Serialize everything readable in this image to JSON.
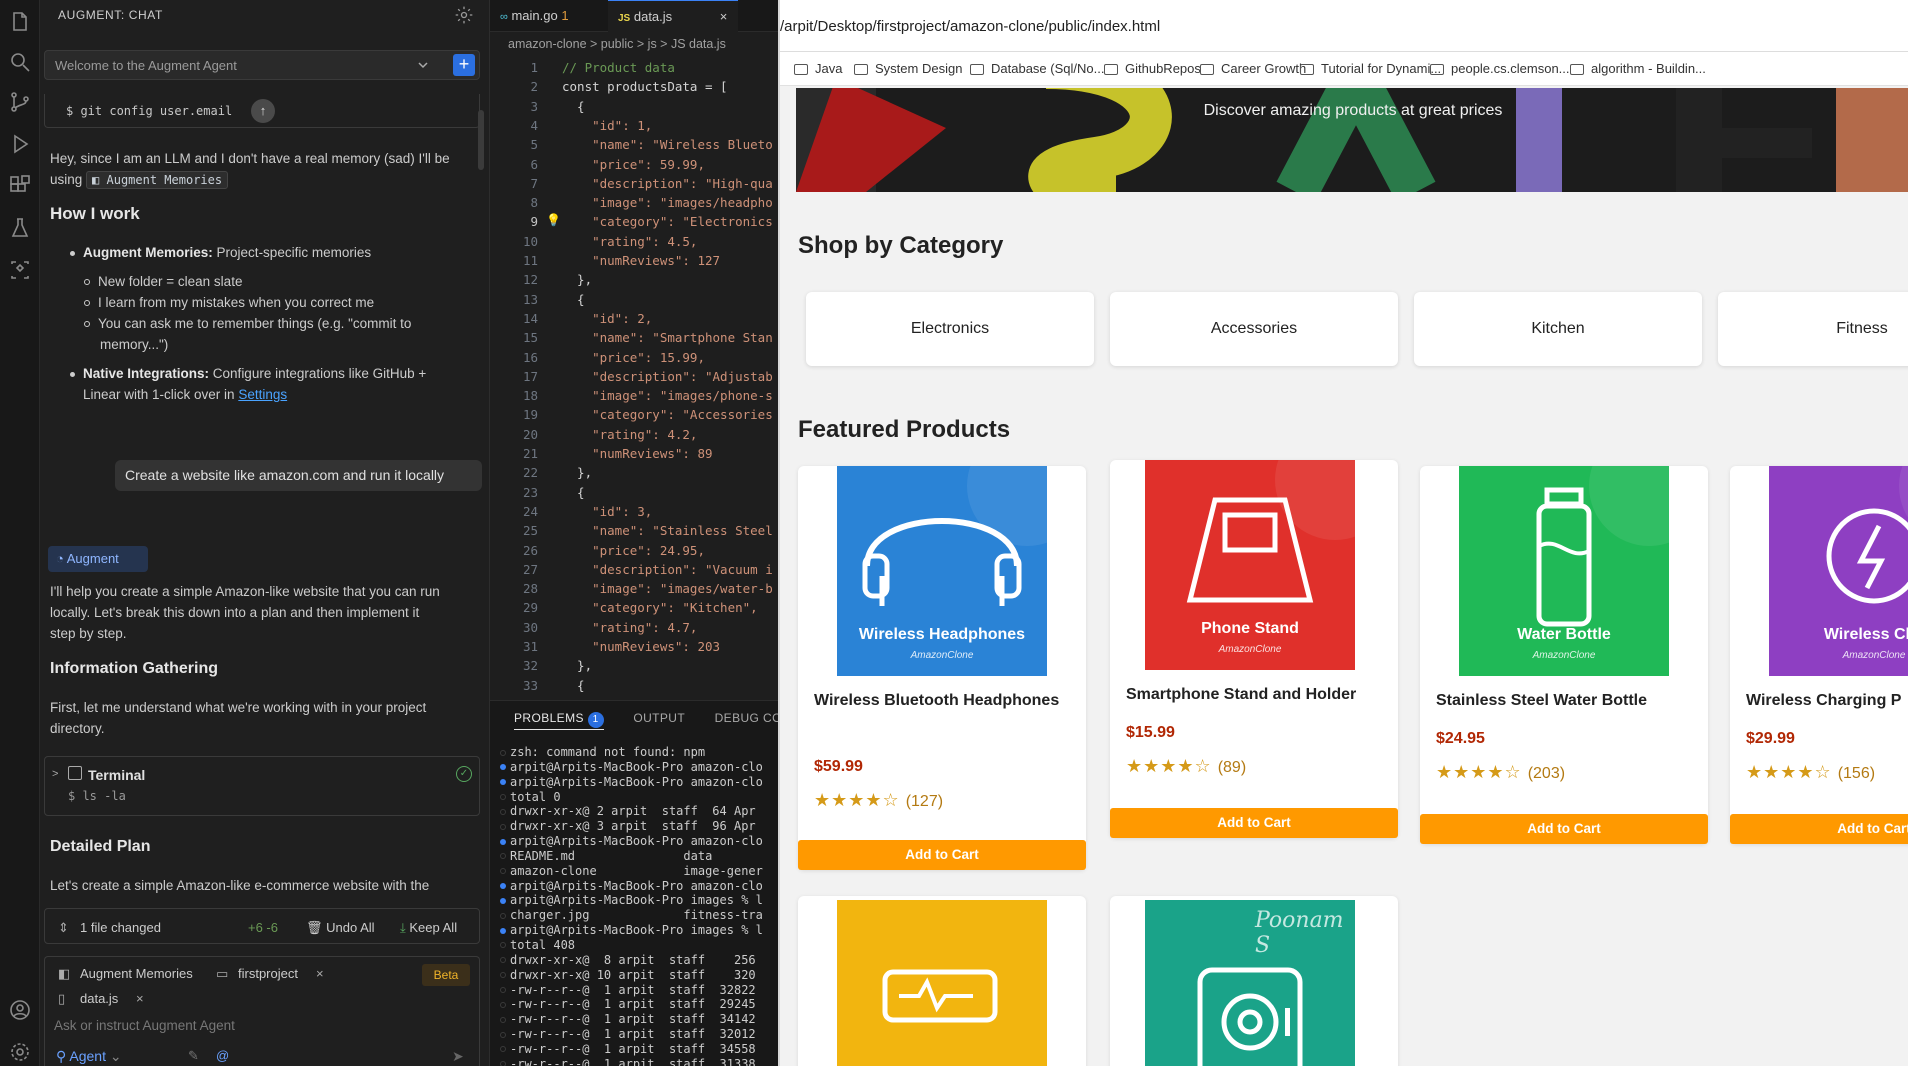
{
  "chat": {
    "title": "AUGMENT: CHAT",
    "welcome": "Welcome to the Augment Agent",
    "git_command": "$ git config user.email",
    "intro": "Hey, since I am an LLM and I don't have a real memory (sad) I'll be using",
    "intro_chip": "Augment Memories",
    "how_title": "How I work",
    "mem_label": "Augment Memories:",
    "mem_text": "Project-specific memories",
    "sub1": "New folder = clean slate",
    "sub2": "I learn from my mistakes when you correct me",
    "sub3_a": "You can ask me to remember things (e.g. \"commit to",
    "sub3_b": "memory...\")",
    "native_label": "Native Integrations:",
    "native_text_a": "Configure integrations like GitHub +",
    "native_text_b": "Linear with 1-click over in",
    "settings_link": "Settings",
    "user_msg": "Create a website like amazon.com and run it locally",
    "agent_tag": "Augment",
    "reply_a": "I'll help you create a simple Amazon-like website that you can run",
    "reply_b": "locally. Let's break this down into a plan and then implement it",
    "reply_c": "step by step.",
    "info_title": "Information Gathering",
    "info_a": "First, let me understand what we're working with in your project",
    "info_b": "directory.",
    "terminal_title": "Terminal",
    "terminal_cmd": "$ ls -la",
    "plan_title": "Detailed Plan",
    "plan_text": "Let's create a simple Amazon-like e-commerce website with the",
    "files_changed": "1 file changed",
    "diff": "+6 -6",
    "undo_all": "Undo All",
    "keep_all": "Keep All",
    "ctx_memories": "Augment Memories",
    "ctx_project": "firstproject",
    "ctx_beta": "Beta",
    "ctx_file": "data.js",
    "input_placeholder": "Ask or instruct Augment Agent",
    "mode": "Agent"
  },
  "editor": {
    "tab1": "main.go",
    "tab1_badge": "1",
    "tab2": "data.js",
    "crumb": "amazon-clone > public > js > JS data.js",
    "lines": [
      {
        "n": "1",
        "t": "// Product data"
      },
      {
        "n": "2",
        "t": "const productsData = ["
      },
      {
        "n": "3",
        "t": "  {"
      },
      {
        "n": "4",
        "t": "    \"id\": 1,"
      },
      {
        "n": "5",
        "t": "    \"name\": \"Wireless Blueto"
      },
      {
        "n": "6",
        "t": "    \"price\": 59.99,"
      },
      {
        "n": "7",
        "t": "    \"description\": \"High-qua"
      },
      {
        "n": "8",
        "t": "    \"image\": \"images/headpho"
      },
      {
        "n": "9",
        "t": "    \"category\": \"Electronics"
      },
      {
        "n": "10",
        "t": "    \"rating\": 4.5,"
      },
      {
        "n": "11",
        "t": "    \"numReviews\": 127"
      },
      {
        "n": "12",
        "t": "  },"
      },
      {
        "n": "13",
        "t": "  {"
      },
      {
        "n": "14",
        "t": "    \"id\": 2,"
      },
      {
        "n": "15",
        "t": "    \"name\": \"Smartphone Stan"
      },
      {
        "n": "16",
        "t": "    \"price\": 15.99,"
      },
      {
        "n": "17",
        "t": "    \"description\": \"Adjustab"
      },
      {
        "n": "18",
        "t": "    \"image\": \"images/phone-s"
      },
      {
        "n": "19",
        "t": "    \"category\": \"Accessories"
      },
      {
        "n": "20",
        "t": "    \"rating\": 4.2,"
      },
      {
        "n": "21",
        "t": "    \"numReviews\": 89"
      },
      {
        "n": "22",
        "t": "  },"
      },
      {
        "n": "23",
        "t": "  {"
      },
      {
        "n": "24",
        "t": "    \"id\": 3,"
      },
      {
        "n": "25",
        "t": "    \"name\": \"Stainless Steel"
      },
      {
        "n": "26",
        "t": "    \"price\": 24.95,"
      },
      {
        "n": "27",
        "t": "    \"description\": \"Vacuum i"
      },
      {
        "n": "28",
        "t": "    \"image\": \"images/water-b"
      },
      {
        "n": "29",
        "t": "    \"category\": \"Kitchen\","
      },
      {
        "n": "30",
        "t": "    \"rating\": 4.7,"
      },
      {
        "n": "31",
        "t": "    \"numReviews\": 203"
      },
      {
        "n": "32",
        "t": "  },"
      },
      {
        "n": "33",
        "t": "  {"
      }
    ]
  },
  "panel": {
    "problems": "PROBLEMS",
    "problems_count": "1",
    "output": "OUTPUT",
    "debug": "DEBUG CONS",
    "lines": [
      {
        "dot": "",
        "t": "zsh: command not found: npm"
      },
      {
        "dot": "blue",
        "t": "arpit@Arpits-MacBook-Pro amazon-clo"
      },
      {
        "dot": "blue",
        "t": "arpit@Arpits-MacBook-Pro amazon-clo"
      },
      {
        "dot": "",
        "t": "total 0"
      },
      {
        "dot": "",
        "t": "drwxr-xr-x@ 2 arpit  staff  64 Apr"
      },
      {
        "dot": "",
        "t": "drwxr-xr-x@ 3 arpit  staff  96 Apr"
      },
      {
        "dot": "blue",
        "t": "arpit@Arpits-MacBook-Pro amazon-clo"
      },
      {
        "dot": "",
        "t": "README.md               data"
      },
      {
        "dot": "",
        "t": "amazon-clone            image-gener"
      },
      {
        "dot": "blue",
        "t": "arpit@Arpits-MacBook-Pro amazon-clo"
      },
      {
        "dot": "blue",
        "t": "arpit@Arpits-MacBook-Pro images % l"
      },
      {
        "dot": "",
        "t": "charger.jpg             fitness-tra"
      },
      {
        "dot": "blue",
        "t": "arpit@Arpits-MacBook-Pro images % l"
      },
      {
        "dot": "",
        "t": "total 408"
      },
      {
        "dot": "",
        "t": "drwxr-xr-x@  8 arpit  staff    256"
      },
      {
        "dot": "",
        "t": "drwxr-xr-x@ 10 arpit  staff    320"
      },
      {
        "dot": "",
        "t": "-rw-r--r--@  1 arpit  staff  32822"
      },
      {
        "dot": "",
        "t": "-rw-r--r--@  1 arpit  staff  29245"
      },
      {
        "dot": "",
        "t": "-rw-r--r--@  1 arpit  staff  34142"
      },
      {
        "dot": "",
        "t": "-rw-r--r--@  1 arpit  staff  32012"
      },
      {
        "dot": "",
        "t": "-rw-r--r--@  1 arpit  staff  34558"
      },
      {
        "dot": "",
        "t": "-rw-r--r--@  1 arpit  staff  31338"
      }
    ]
  },
  "browser": {
    "url": "/arpit/Desktop/firstproject/amazon-clone/public/index.html",
    "bookmarks": [
      "Java",
      "System Design",
      "Database (Sql/No...",
      "GithubRepos",
      "Career Growth",
      "Tutorial for Dynami...",
      "people.cs.clemson...",
      "algorithm - Buildin..."
    ],
    "hero_text": "Discover amazing products at great prices",
    "shop_title": "Shop by Category",
    "categories": [
      "Electronics",
      "Accessories",
      "Kitchen",
      "Fitness"
    ],
    "featured_title": "Featured Products",
    "products": [
      {
        "img_title": "Wireless Headphones",
        "brand": "AmazonClone",
        "name": "Wireless Bluetooth Headphones",
        "price": "$59.99",
        "stars": "★★★★☆",
        "reviews": "(127)",
        "cart": "Add to Cart",
        "color": "#2a83d6"
      },
      {
        "img_title": "Phone Stand",
        "brand": "AmazonClone",
        "name": "Smartphone Stand and Holder",
        "price": "$15.99",
        "stars": "★★★★☆",
        "reviews": "(89)",
        "cart": "Add to Cart",
        "color": "#e0302b"
      },
      {
        "img_title": "Water Bottle",
        "brand": "AmazonClone",
        "name": "Stainless Steel Water Bottle",
        "price": "$24.95",
        "stars": "★★★★☆",
        "reviews": "(203)",
        "cart": "Add to Cart",
        "color": "#20b957"
      },
      {
        "img_title": "Wireless Cha",
        "brand": "AmazonClone",
        "name": "Wireless Charging P",
        "price": "$29.99",
        "stars": "★★★★☆",
        "reviews": "(156)",
        "cart": "Add to Cart",
        "color": "#8e3fc2"
      }
    ],
    "row2_colors": [
      "#f2b50f",
      "#1aa389"
    ],
    "row2_signature": "Poonam S"
  }
}
